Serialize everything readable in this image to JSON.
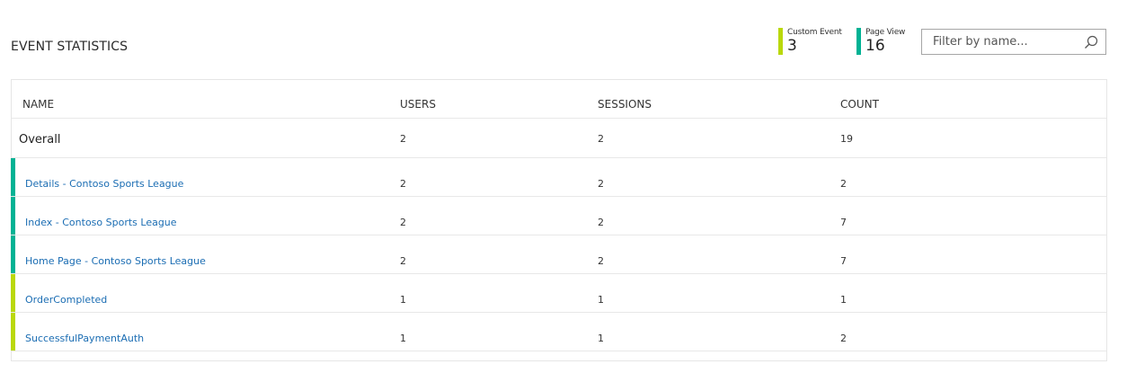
{
  "header": {
    "title": "EVENT STATISTICS"
  },
  "legend": {
    "custom": {
      "label": "Custom Event",
      "value": "3",
      "color": "#bad80a"
    },
    "page": {
      "label": "Page View",
      "value": "16",
      "color": "#00b294"
    }
  },
  "search": {
    "placeholder": "Filter by name...",
    "value": "",
    "icon": "search-icon"
  },
  "table": {
    "columns": [
      "NAME",
      "USERS",
      "SESSIONS",
      "COUNT"
    ],
    "overall": {
      "name": "Overall",
      "users": "2",
      "sessions": "2",
      "count": "19"
    },
    "rows": [
      {
        "name": "Details - Contoso Sports League",
        "users": "2",
        "sessions": "2",
        "count": "2",
        "type": "page",
        "color": "#00b294"
      },
      {
        "name": "Index - Contoso Sports League",
        "users": "2",
        "sessions": "2",
        "count": "7",
        "type": "page",
        "color": "#00b294"
      },
      {
        "name": "Home Page - Contoso Sports League",
        "users": "2",
        "sessions": "2",
        "count": "7",
        "type": "page",
        "color": "#00b294"
      },
      {
        "name": "OrderCompleted",
        "users": "1",
        "sessions": "1",
        "count": "1",
        "type": "custom",
        "color": "#bad80a"
      },
      {
        "name": "SuccessfulPaymentAuth",
        "users": "1",
        "sessions": "1",
        "count": "2",
        "type": "custom",
        "color": "#bad80a"
      }
    ]
  }
}
